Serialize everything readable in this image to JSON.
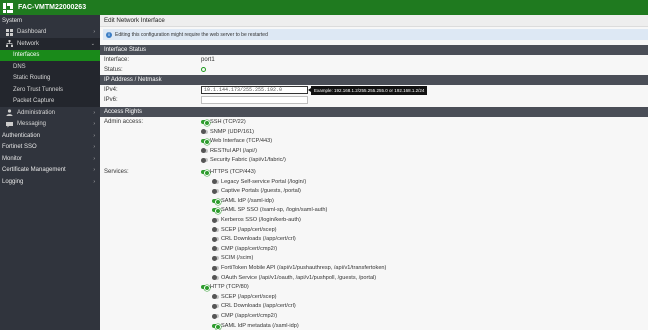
{
  "app": {
    "device_name": "FAC-VMTM22000263"
  },
  "sidebar": {
    "items": [
      {
        "label": "System",
        "level": 0,
        "icon": "",
        "chevron": ""
      },
      {
        "label": "Dashboard",
        "level": 1,
        "icon": "dashboard-icon",
        "chevron": "›"
      },
      {
        "label": "Network",
        "level": 1,
        "icon": "network-icon",
        "chevron": "⌄"
      },
      {
        "label": "Interfaces",
        "level": 2,
        "icon": "",
        "chevron": ""
      },
      {
        "label": "DNS",
        "level": 2,
        "icon": "",
        "chevron": ""
      },
      {
        "label": "Static Routing",
        "level": 2,
        "icon": "",
        "chevron": ""
      },
      {
        "label": "Zero Trust Tunnels",
        "level": 2,
        "icon": "",
        "chevron": ""
      },
      {
        "label": "Packet Capture",
        "level": 2,
        "icon": "",
        "chevron": ""
      },
      {
        "label": "Administration",
        "level": 1,
        "icon": "user-icon",
        "chevron": "›"
      },
      {
        "label": "Messaging",
        "level": 1,
        "icon": "messaging-icon",
        "chevron": "›"
      },
      {
        "label": "Authentication",
        "level": 0,
        "icon": "",
        "chevron": "›"
      },
      {
        "label": "Fortinet SSO",
        "level": 0,
        "icon": "",
        "chevron": "›"
      },
      {
        "label": "Monitor",
        "level": 0,
        "icon": "",
        "chevron": "›"
      },
      {
        "label": "Certificate Management",
        "level": 0,
        "icon": "",
        "chevron": "›"
      },
      {
        "label": "Logging",
        "level": 0,
        "icon": "",
        "chevron": "›"
      }
    ]
  },
  "page": {
    "title": "Edit Network Interface",
    "warning": "Editing this configuration might require the web server to be restarted"
  },
  "interface_status": {
    "header": "Interface Status",
    "interface_label": "Interface:",
    "interface_value": "port1",
    "status_label": "Status:"
  },
  "ip": {
    "header": "IP Address / Netmask",
    "ipv4_label": "IPv4:",
    "ipv4_value": "10.1.144.173/255.255.192.0",
    "ipv4_tooltip": "Example: 192.168.1.2/255.255.255.0 or 192.168.1.2/24",
    "ipv6_label": "IPv6:",
    "ipv6_value": ""
  },
  "access": {
    "header": "Access Rights",
    "admin_label": "Admin access:",
    "admin_options": [
      {
        "label": "SSH (TCP/22)",
        "on": true
      },
      {
        "label": "SNMP (UDP/161)",
        "on": false
      },
      {
        "label": "Web Interface (TCP/443)",
        "on": true
      },
      {
        "label": "RESTful API (/api/)",
        "on": false
      },
      {
        "label": "Security Fabric (/api/v1/fabric/)",
        "on": false
      }
    ],
    "services_label": "Services:",
    "services": [
      {
        "label": "HTTPS (TCP/443)",
        "on": true,
        "sub": false
      },
      {
        "label": "Legacy Self-service Portal (/login/)",
        "on": false,
        "sub": true
      },
      {
        "label": "Captive Portals (/guests, /portal)",
        "on": false,
        "sub": true
      },
      {
        "label": "SAML IdP (/saml-idp)",
        "on": true,
        "sub": true
      },
      {
        "label": "SAML SP SSO (/saml-sp, /login/saml-auth)",
        "on": true,
        "sub": true
      },
      {
        "label": "Kerberos SSO (/login/kerb-auth)",
        "on": false,
        "sub": true
      },
      {
        "label": "SCEP (/app/cert/scep)",
        "on": false,
        "sub": true
      },
      {
        "label": "CRL Downloads (/app/cert/crl)",
        "on": false,
        "sub": true
      },
      {
        "label": "CMP (/app/cert/cmp2/)",
        "on": false,
        "sub": true
      },
      {
        "label": "SCIM (/scim)",
        "on": false,
        "sub": true
      },
      {
        "label": "FortiToken Mobile API (/api/v1/pushauthresp, /api/v1/transfertoken)",
        "on": false,
        "sub": true
      },
      {
        "label": "OAuth Service (/api/v1/oauth, /api/v1/pushpoll, /guests, /portal)",
        "on": false,
        "sub": true
      },
      {
        "label": "HTTP (TCP/80)",
        "on": true,
        "sub": false
      },
      {
        "label": "SCEP (/app/cert/scep)",
        "on": false,
        "sub": true
      },
      {
        "label": "CRL Downloads (/app/cert/crl)",
        "on": false,
        "sub": true
      },
      {
        "label": "CMP (/app/cert/cmp2/)",
        "on": false,
        "sub": true
      },
      {
        "label": "SAML IdP metadata (/saml-idp)",
        "on": true,
        "sub": true
      }
    ]
  },
  "colors": {
    "brand_green": "#1f7a1f",
    "sidebar_bg": "#30343d",
    "active_item": "#1a8a1a",
    "section_header": "#4a4e57"
  }
}
